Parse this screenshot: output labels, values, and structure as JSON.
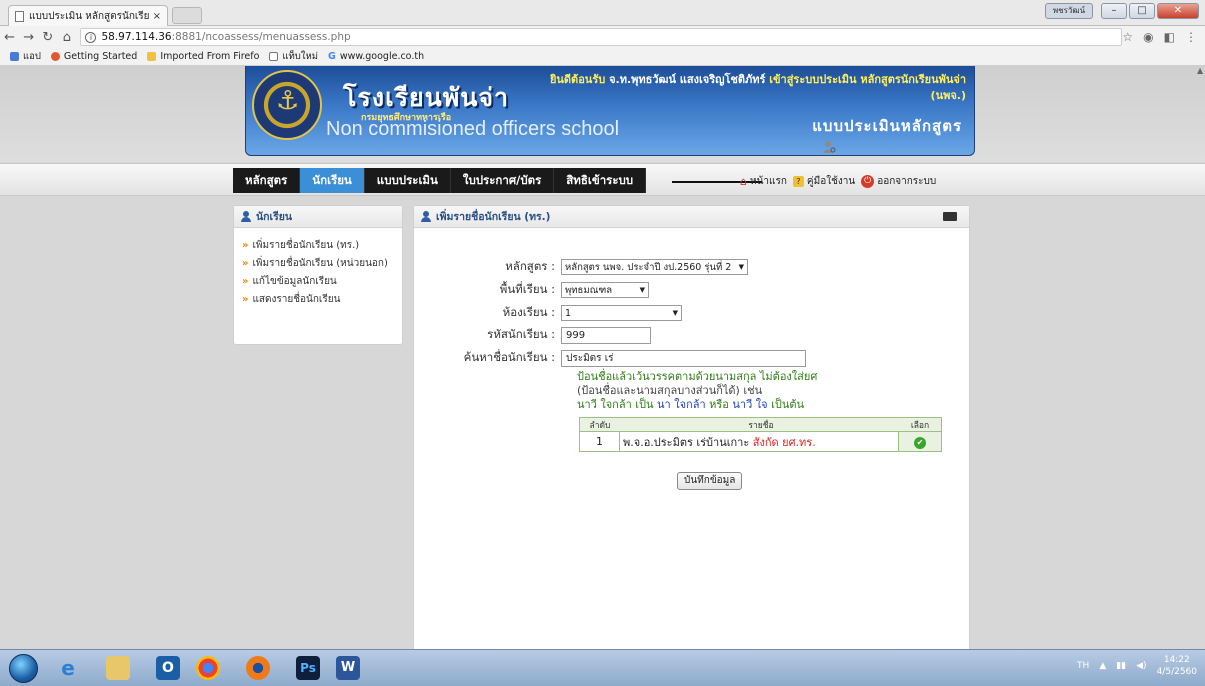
{
  "browser": {
    "tab_title": "แบบประเมิน หลักสูตรนักเรีย",
    "tab_close": "×",
    "url_host": "58.97.114.36",
    "url_path": ":8881/ncoassess/menuassess.php",
    "user_badge": "พชรวัฒน์",
    "bookmarks": [
      {
        "label": "แอป",
        "color": "#4a7ad8"
      },
      {
        "label": "Getting Started",
        "color": "#e4572e"
      },
      {
        "label": "Imported From Firefo",
        "color": "#f0c040"
      },
      {
        "label": "แท็บใหม่",
        "color": "#ffffff"
      },
      {
        "label": "www.google.co.th",
        "color": "#4285f4"
      }
    ]
  },
  "header": {
    "school_th": "โรงเรียนพันจ่า",
    "school_sub": "กรมยุทธศึกษาทหารเรือ",
    "school_en": "Non commisioned officers school",
    "welcome_prefix": "ยินดีต้อนรับ",
    "welcome_user": "จ.ท.พุทธวัฒน์ แสงเจริญโชติภัทร์",
    "welcome_mid": "เข้าสู่ระบบประเมิน",
    "welcome_course": "หลักสูตรนักเรียนพันจ่า (นพจ.)",
    "system_title": "แบบประเมินหลักสูตร"
  },
  "menu": {
    "items": [
      "หลักสูตร",
      "นักเรียน",
      "แบบประเมิน",
      "ใบประกาศ/บัตร",
      "สิทธิเข้าระบบ"
    ],
    "home": "หน้าแรก",
    "manual": "คู่มือใช้งาน",
    "logout": "ออกจากระบบ"
  },
  "sidebar": {
    "title": "นักเรียน",
    "items": [
      "เพิ่มรายชื่อนักเรียน (ทร.)",
      "เพิ่มรายชื่อนักเรียน (หน่วยนอก)",
      "แก้ไขข้อมูลนักเรียน",
      "แสดงรายชื่อนักเรียน"
    ]
  },
  "content": {
    "title": "เพิ่มรายชื่อนักเรียน (ทร.)",
    "form": {
      "course_label": "หลักสูตร :",
      "course_value": "หลักสูตร นพจ. ประจำปี งป.2560 รุ่นที่ 2",
      "area_label": "พื้นที่เรียน :",
      "area_value": "พุทธมณฑล",
      "room_label": "ห้องเรียน :",
      "room_value": "1",
      "student_id_label": "รหัสนักเรียน :",
      "student_id_value": "999",
      "search_label": "ค้นหาชื่อนักเรียน :",
      "search_value": "ประมิตร เร่"
    },
    "hint": {
      "line1": "ป้อนชื่อแล้วเว้นวรรคตามด้วยนามสกุล ไม่ต้องใส่ยศ",
      "line2": "(ป้อนชื่อและนามสกุลบางส่วนก็ได้) เช่น",
      "ex_name": "นาวี ใจกล้า",
      "ex_as": "เป็น",
      "ex_a": "นา ใจกล้า",
      "ex_or": "หรือ",
      "ex_b": "นาวี ใจ",
      "ex_end": "เป็นต้น"
    },
    "results": {
      "headers": [
        "ลำดับ",
        "รายชื่อ",
        "เลือก"
      ],
      "rows": [
        {
          "no": "1",
          "name": "พ.จ.อ.ประมิตร  เร่บ้านเกาะ",
          "unit": "สังกัด ยศ.ทร."
        }
      ]
    },
    "save_button": "บันทึกข้อมูล"
  },
  "taskbar": {
    "lang": "TH",
    "time": "14:22",
    "date": "4/5/2560"
  }
}
